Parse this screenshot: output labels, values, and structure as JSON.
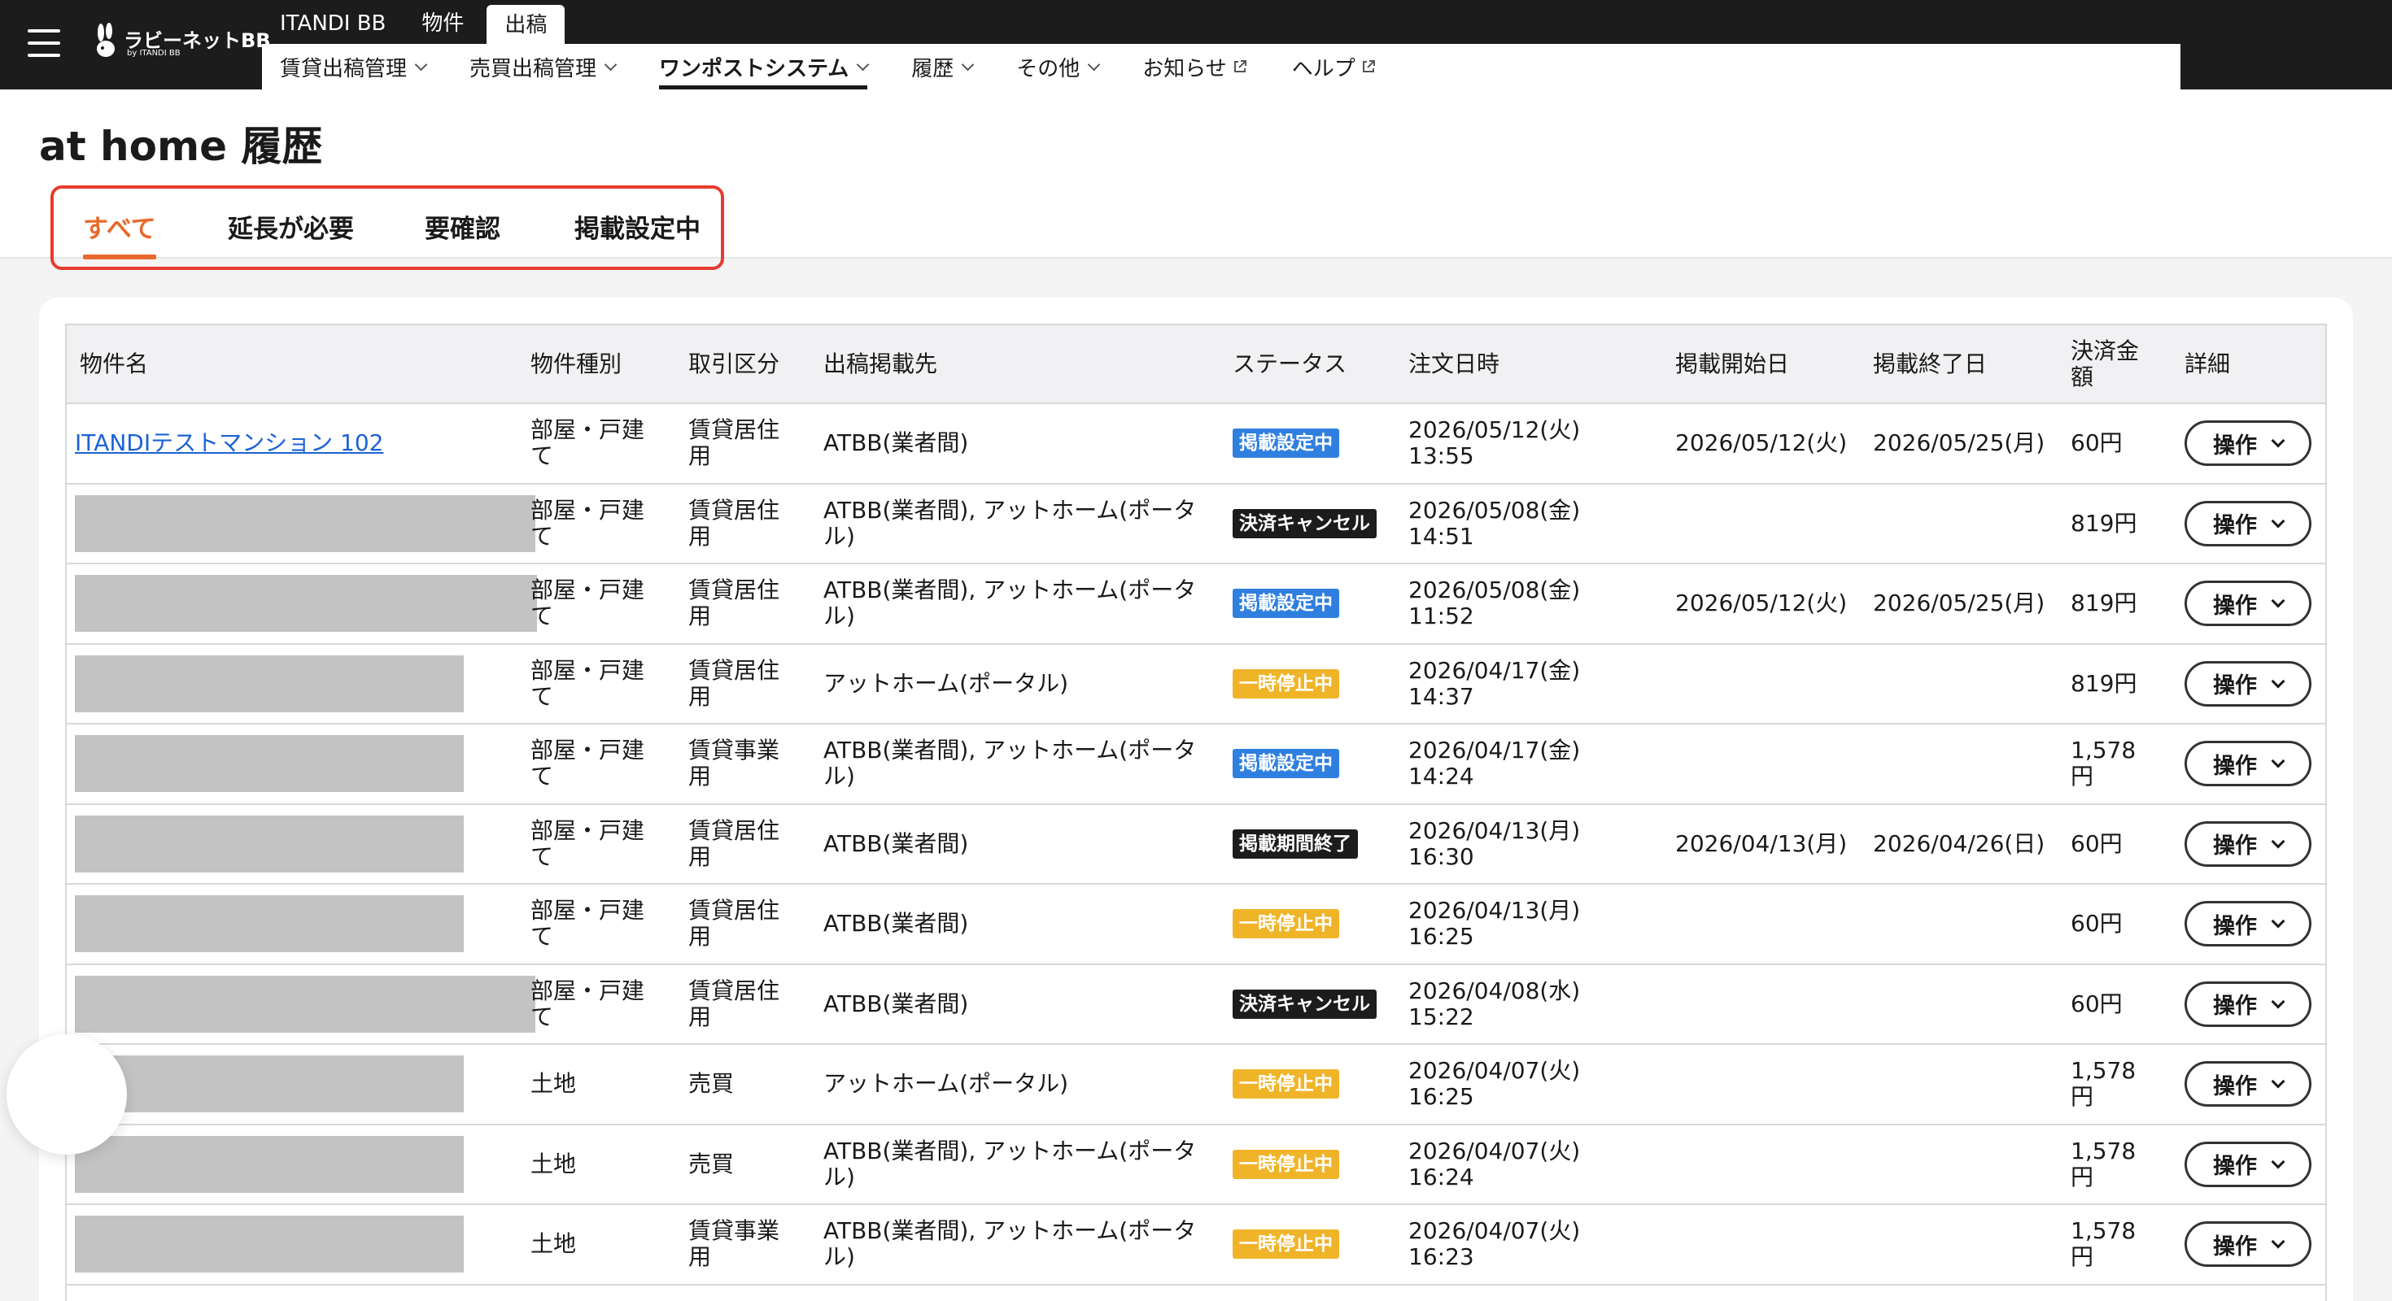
{
  "header": {
    "logo_text": "ラビーネットBB",
    "logo_sub": "by ITANDI BB",
    "top_tabs": [
      "ITANDI BB",
      "物件",
      "出稿"
    ],
    "active_top_tab": "出稿",
    "subnav": [
      {
        "label": "賃貸出稿管理",
        "type": "dropdown"
      },
      {
        "label": "売買出稿管理",
        "type": "dropdown"
      },
      {
        "label": "ワンポストシステム",
        "type": "dropdown",
        "active": true
      },
      {
        "label": "履歴",
        "type": "dropdown"
      },
      {
        "label": "その他",
        "type": "dropdown"
      },
      {
        "label": "お知らせ",
        "type": "external"
      },
      {
        "label": "ヘルプ",
        "type": "external"
      }
    ]
  },
  "page": {
    "title": "at home 履歴",
    "filter_tabs": [
      "すべて",
      "延長が必要",
      "要確認",
      "掲載設定中"
    ],
    "active_filter": "すべて"
  },
  "colors": {
    "accent_orange": "#e8692b",
    "highlight_red": "#e63c2e",
    "link_blue": "#1b62d6",
    "badge_blue": "#2f7fe0",
    "badge_dark": "#1c1c1c",
    "badge_yellow": "#f0b429"
  },
  "table": {
    "columns": [
      "物件名",
      "物件種別",
      "取引区分",
      "出稿掲載先",
      "ステータス",
      "注文日時",
      "掲載開始日",
      "掲載終了日",
      "決済金額",
      "詳細"
    ],
    "action_label": "操作",
    "rows": [
      {
        "name": "ITANDIテストマンション 102",
        "redacted": false,
        "type": "部屋・戸建て",
        "category": "賃貸居住用",
        "destination": "ATBB(業者間)",
        "status": "掲載設定中",
        "status_color": "blue",
        "ordered": "2026/05/12(火) 13:55",
        "start": "2026/05/12(火)",
        "end": "2026/05/25(月)",
        "amount": "60円"
      },
      {
        "name": "",
        "redacted": true,
        "type": "部屋・戸建て",
        "category": "賃貸居住用",
        "destination": "ATBB(業者間), アットホーム(ポータル)",
        "status": "決済キャンセル",
        "status_color": "dark",
        "ordered": "2026/05/08(金) 14:51",
        "start": "",
        "end": "",
        "amount": "819円"
      },
      {
        "name": "",
        "redacted": true,
        "type": "部屋・戸建て",
        "category": "賃貸居住用",
        "destination": "ATBB(業者間), アットホーム(ポータル)",
        "status": "掲載設定中",
        "status_color": "blue",
        "ordered": "2026/05/08(金) 11:52",
        "start": "2026/05/12(火)",
        "end": "2026/05/25(月)",
        "amount": "819円"
      },
      {
        "name": "",
        "redacted": true,
        "type": "部屋・戸建て",
        "category": "賃貸居住用",
        "destination": "アットホーム(ポータル)",
        "status": "一時停止中",
        "status_color": "yellow",
        "ordered": "2026/04/17(金) 14:37",
        "start": "",
        "end": "",
        "amount": "819円"
      },
      {
        "name": "",
        "redacted": true,
        "type": "部屋・戸建て",
        "category": "賃貸事業用",
        "destination": "ATBB(業者間), アットホーム(ポータル)",
        "status": "掲載設定中",
        "status_color": "blue",
        "ordered": "2026/04/17(金) 14:24",
        "start": "",
        "end": "",
        "amount": "1,578円"
      },
      {
        "name": "",
        "redacted": true,
        "type": "部屋・戸建て",
        "category": "賃貸居住用",
        "destination": "ATBB(業者間)",
        "status": "掲載期間終了",
        "status_color": "dark",
        "ordered": "2026/04/13(月) 16:30",
        "start": "2026/04/13(月)",
        "end": "2026/04/26(日)",
        "amount": "60円"
      },
      {
        "name": "",
        "redacted": true,
        "type": "部屋・戸建て",
        "category": "賃貸居住用",
        "destination": "ATBB(業者間)",
        "status": "一時停止中",
        "status_color": "yellow",
        "ordered": "2026/04/13(月) 16:25",
        "start": "",
        "end": "",
        "amount": "60円"
      },
      {
        "name": "",
        "redacted": true,
        "type": "部屋・戸建て",
        "category": "賃貸居住用",
        "destination": "ATBB(業者間)",
        "status": "決済キャンセル",
        "status_color": "dark",
        "ordered": "2026/04/08(水) 15:22",
        "start": "",
        "end": "",
        "amount": "60円"
      },
      {
        "name": "",
        "redacted": true,
        "type": "土地",
        "category": "売買",
        "destination": "アットホーム(ポータル)",
        "status": "一時停止中",
        "status_color": "yellow",
        "ordered": "2026/04/07(火) 16:25",
        "start": "",
        "end": "",
        "amount": "1,578円"
      },
      {
        "name": "",
        "redacted": true,
        "type": "土地",
        "category": "売買",
        "destination": "ATBB(業者間), アットホーム(ポータル)",
        "status": "一時停止中",
        "status_color": "yellow",
        "ordered": "2026/04/07(火) 16:24",
        "start": "",
        "end": "",
        "amount": "1,578円"
      },
      {
        "name": "",
        "redacted": true,
        "type": "土地",
        "category": "賃貸事業用",
        "destination": "ATBB(業者間), アットホーム(ポータル)",
        "status": "一時停止中",
        "status_color": "yellow",
        "ordered": "2026/04/07(火) 16:23",
        "start": "",
        "end": "",
        "amount": "1,578円"
      }
    ]
  }
}
